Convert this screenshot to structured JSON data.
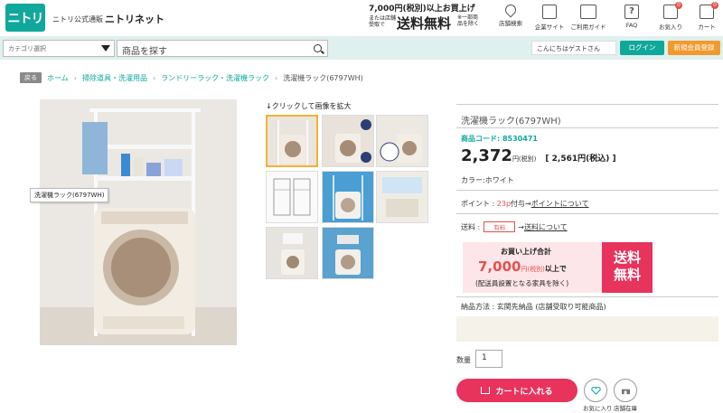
{
  "header": {
    "logo_text": "ニトリ",
    "site_sub": "ニトリ公式通販",
    "site_name": "ニトリネット",
    "promo": {
      "line1": "7,000円(税別)以上お買上げ",
      "left_note": "または店舗受取で",
      "main": "送料無料",
      "right_note": "※一部商品を除く"
    },
    "icons": [
      {
        "name": "store-search-icon",
        "label": "店舗検索"
      },
      {
        "name": "company-site-icon",
        "label": "企業サイト"
      },
      {
        "name": "guide-icon",
        "label": "ご利用ガイド"
      },
      {
        "name": "faq-icon",
        "label": "FAQ"
      },
      {
        "name": "favorites-icon",
        "label": "お気入り",
        "badge": "0"
      },
      {
        "name": "cart-icon",
        "label": "カート",
        "badge": "0"
      }
    ]
  },
  "searchbar": {
    "category_label": "カテゴリ選択",
    "search_placeholder": "商品を探す",
    "greeting": "こんにちはゲストさん",
    "login_label": "ログイン",
    "register_label": "新規会員登録"
  },
  "breadcrumb": {
    "back": "戻る",
    "items": [
      "ホーム",
      "掃除道具・洗濯用品",
      "ランドリーラック・洗濯機ラック"
    ],
    "current": "洗濯機ラック(6797WH)"
  },
  "gallery": {
    "hover_tip": "洗濯機ラック(6797WH)",
    "caption": "↓クリックして画像を拡大"
  },
  "product": {
    "name": "洗濯機ラック(6797WH)",
    "code_label": "商品コード: ",
    "code": "8530471",
    "price": "2,372",
    "price_unit": "円(税別)",
    "price_incl": "[ 2,561円(税込) ]",
    "color": "カラー:ホワイト",
    "points_prefix": "ポイント : ",
    "points_value": "23p",
    "points_suffix": "付与→",
    "points_link": "ポイントについて",
    "shipping_label": "送料 : ",
    "shipping_tag": "有料",
    "shipping_arrow": "→",
    "shipping_link": "送料について",
    "banner_title": "お買い上げ合計",
    "banner_amount": "7,000",
    "banner_unit": "円(税別)",
    "banner_suffix": "以上で",
    "banner_note": "(配送員設置となる家具を除く)",
    "free_line1": "送料",
    "free_line2": "無料",
    "delivery": "納品方法 : 玄関先納品 (店舗受取り可能商品)",
    "qty_label": "数量",
    "qty_value": "1",
    "cart_label": "カートに入れる",
    "fav_label": "お気に入り",
    "stock_label": "店舗在庫"
  },
  "colors": {
    "brand": "#10a89b",
    "accent": "#e8335d",
    "orange": "#f29a2e"
  }
}
